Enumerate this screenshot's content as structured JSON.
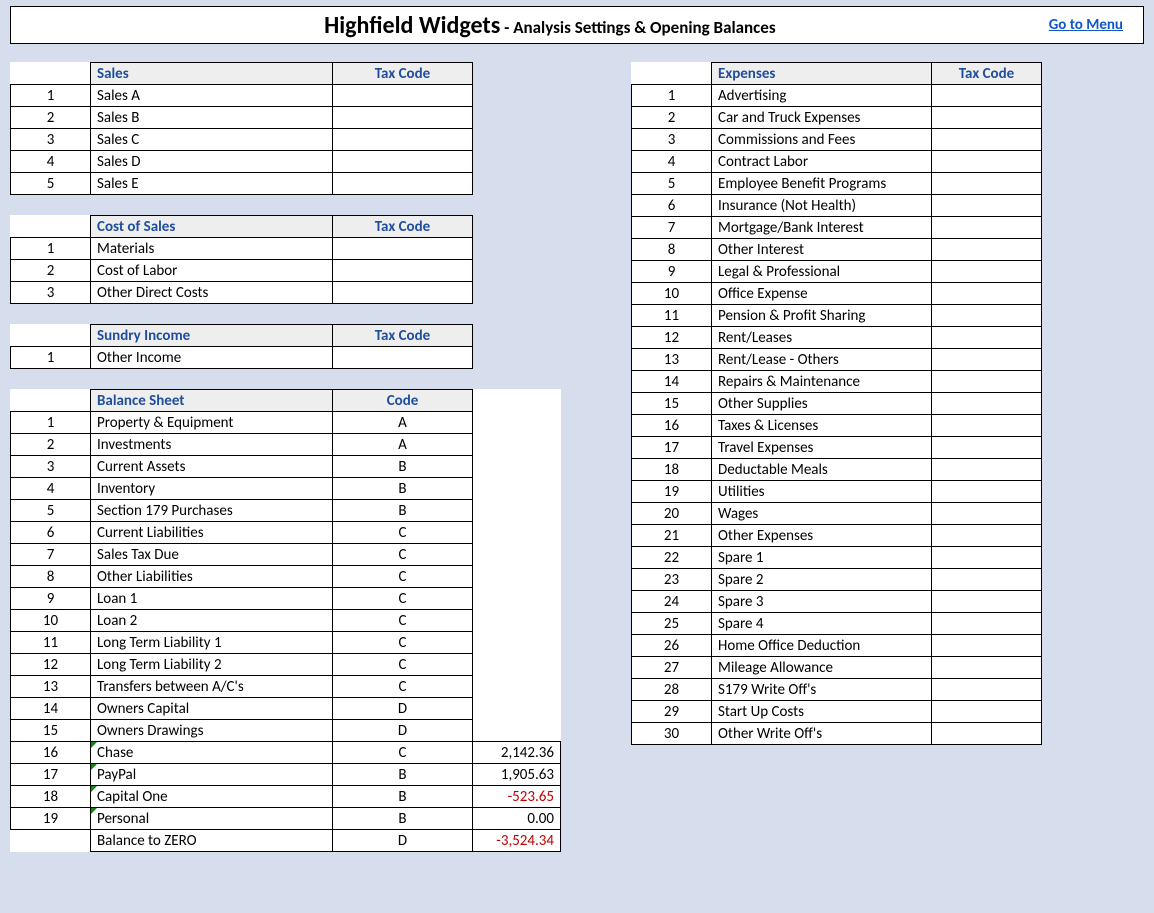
{
  "header": {
    "company": "Highfield Widgets",
    "separator": "  -  ",
    "subtitle": "Analysis Settings & Opening Balances",
    "menu_link": "Go to Menu"
  },
  "left": {
    "sales": {
      "title": "Sales",
      "code_label": "Tax Code",
      "rows": [
        {
          "n": "1",
          "name": "Sales A",
          "code": ""
        },
        {
          "n": "2",
          "name": "Sales B",
          "code": ""
        },
        {
          "n": "3",
          "name": "Sales C",
          "code": ""
        },
        {
          "n": "4",
          "name": "Sales D",
          "code": ""
        },
        {
          "n": "5",
          "name": "Sales E",
          "code": ""
        }
      ]
    },
    "cost_of_sales": {
      "title": "Cost of Sales",
      "code_label": "Tax Code",
      "rows": [
        {
          "n": "1",
          "name": "Materials",
          "code": ""
        },
        {
          "n": "2",
          "name": "Cost of Labor",
          "code": ""
        },
        {
          "n": "3",
          "name": "Other Direct Costs",
          "code": ""
        }
      ]
    },
    "sundry": {
      "title": "Sundry Income",
      "code_label": "Tax Code",
      "rows": [
        {
          "n": "1",
          "name": "Other Income",
          "code": ""
        }
      ]
    },
    "balance_sheet": {
      "title": "Balance Sheet",
      "code_label": "Code",
      "rows": [
        {
          "n": "1",
          "name": "Property & Equipment",
          "code": "A",
          "val": "",
          "neg": false,
          "mark": false
        },
        {
          "n": "2",
          "name": "Investments",
          "code": "A",
          "val": "",
          "neg": false,
          "mark": false
        },
        {
          "n": "3",
          "name": "Current Assets",
          "code": "B",
          "val": "",
          "neg": false,
          "mark": false
        },
        {
          "n": "4",
          "name": "Inventory",
          "code": "B",
          "val": "",
          "neg": false,
          "mark": false
        },
        {
          "n": "5",
          "name": "Section 179 Purchases",
          "code": "B",
          "val": "",
          "neg": false,
          "mark": false
        },
        {
          "n": "6",
          "name": "Current Liabilities",
          "code": "C",
          "val": "",
          "neg": false,
          "mark": false
        },
        {
          "n": "7",
          "name": "Sales Tax Due",
          "code": "C",
          "val": "",
          "neg": false,
          "mark": false
        },
        {
          "n": "8",
          "name": "Other Liabilities",
          "code": "C",
          "val": "",
          "neg": false,
          "mark": false
        },
        {
          "n": "9",
          "name": "Loan 1",
          "code": "C",
          "val": "",
          "neg": false,
          "mark": false
        },
        {
          "n": "10",
          "name": "Loan 2",
          "code": "C",
          "val": "",
          "neg": false,
          "mark": false
        },
        {
          "n": "11",
          "name": "Long Term Liability 1",
          "code": "C",
          "val": "",
          "neg": false,
          "mark": false
        },
        {
          "n": "12",
          "name": "Long Term Liability 2",
          "code": "C",
          "val": "",
          "neg": false,
          "mark": false
        },
        {
          "n": "13",
          "name": "Transfers between A/C's",
          "code": "C",
          "val": "",
          "neg": false,
          "mark": false
        },
        {
          "n": "14",
          "name": "Owners Capital",
          "code": "D",
          "val": "",
          "neg": false,
          "mark": false
        },
        {
          "n": "15",
          "name": "Owners Drawings",
          "code": "D",
          "val": "",
          "neg": false,
          "mark": false
        },
        {
          "n": "16",
          "name": "Chase",
          "code": "C",
          "val": "2,142.36",
          "neg": false,
          "mark": true,
          "hasval": true
        },
        {
          "n": "17",
          "name": "PayPal",
          "code": "B",
          "val": "1,905.63",
          "neg": false,
          "mark": true,
          "hasval": true
        },
        {
          "n": "18",
          "name": "Capital One",
          "code": "B",
          "val": "-523.65",
          "neg": true,
          "mark": true,
          "hasval": true
        },
        {
          "n": "19",
          "name": "Personal",
          "code": "B",
          "val": "0.00",
          "neg": false,
          "mark": true,
          "hasval": true
        },
        {
          "n": "",
          "name": "Balance to ZERO",
          "code": "D",
          "val": "-3,524.34",
          "neg": true,
          "mark": false,
          "hasval": true
        }
      ]
    }
  },
  "right": {
    "expenses": {
      "title": "Expenses",
      "code_label": "Tax Code",
      "rows": [
        {
          "n": "1",
          "name": "Advertising",
          "code": ""
        },
        {
          "n": "2",
          "name": "Car and Truck Expenses",
          "code": ""
        },
        {
          "n": "3",
          "name": "Commissions and Fees",
          "code": ""
        },
        {
          "n": "4",
          "name": "Contract Labor",
          "code": ""
        },
        {
          "n": "5",
          "name": "Employee Benefit Programs",
          "code": ""
        },
        {
          "n": "6",
          "name": "Insurance (Not Health)",
          "code": ""
        },
        {
          "n": "7",
          "name": "Mortgage/Bank Interest",
          "code": ""
        },
        {
          "n": "8",
          "name": "Other Interest",
          "code": ""
        },
        {
          "n": "9",
          "name": "Legal & Professional",
          "code": ""
        },
        {
          "n": "10",
          "name": "Office Expense",
          "code": ""
        },
        {
          "n": "11",
          "name": "Pension & Profit Sharing",
          "code": ""
        },
        {
          "n": "12",
          "name": "Rent/Leases",
          "code": ""
        },
        {
          "n": "13",
          "name": "Rent/Lease - Others",
          "code": ""
        },
        {
          "n": "14",
          "name": "Repairs & Maintenance",
          "code": ""
        },
        {
          "n": "15",
          "name": "Other Supplies",
          "code": ""
        },
        {
          "n": "16",
          "name": "Taxes & Licenses",
          "code": ""
        },
        {
          "n": "17",
          "name": "Travel Expenses",
          "code": ""
        },
        {
          "n": "18",
          "name": "Deductable Meals",
          "code": ""
        },
        {
          "n": "19",
          "name": "Utilities",
          "code": ""
        },
        {
          "n": "20",
          "name": "Wages",
          "code": ""
        },
        {
          "n": "21",
          "name": "Other Expenses",
          "code": ""
        },
        {
          "n": "22",
          "name": "Spare 1",
          "code": ""
        },
        {
          "n": "23",
          "name": "Spare 2",
          "code": ""
        },
        {
          "n": "24",
          "name": "Spare 3",
          "code": ""
        },
        {
          "n": "25",
          "name": "Spare 4",
          "code": ""
        },
        {
          "n": "26",
          "name": "Home Office Deduction",
          "code": ""
        },
        {
          "n": "27",
          "name": "Mileage Allowance",
          "code": ""
        },
        {
          "n": "28",
          "name": "S179 Write Off's",
          "code": ""
        },
        {
          "n": "29",
          "name": "Start Up Costs",
          "code": ""
        },
        {
          "n": "30",
          "name": "Other Write Off's",
          "code": ""
        }
      ]
    }
  }
}
